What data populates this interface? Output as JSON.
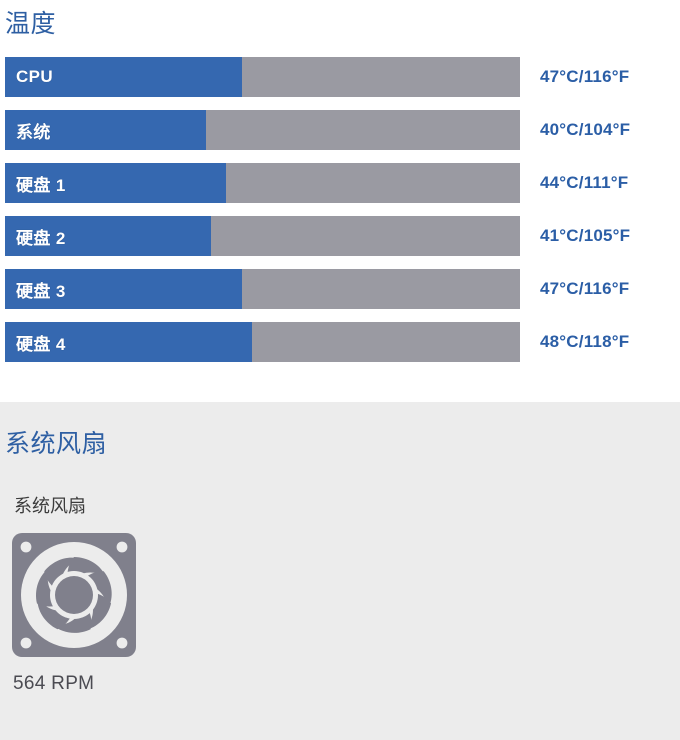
{
  "temperature": {
    "title": "温度",
    "track_color": "#9a9aa2",
    "fill_color": "#3568b0",
    "value_color": "#2b5ea6",
    "rows": [
      {
        "label": "CPU",
        "value": "47°C/116°F",
        "celsius": 47,
        "fahrenheit": 116,
        "fill_percent": 46
      },
      {
        "label": "系统",
        "value": "40°C/104°F",
        "celsius": 40,
        "fahrenheit": 104,
        "fill_percent": 39
      },
      {
        "label": "硬盘 1",
        "value": "44°C/111°F",
        "celsius": 44,
        "fahrenheit": 111,
        "fill_percent": 43
      },
      {
        "label": "硬盘 2",
        "value": "41°C/105°F",
        "celsius": 41,
        "fahrenheit": 105,
        "fill_percent": 40
      },
      {
        "label": "硬盘 3",
        "value": "47°C/116°F",
        "celsius": 47,
        "fahrenheit": 116,
        "fill_percent": 46
      },
      {
        "label": "硬盘 4",
        "value": "48°C/118°F",
        "celsius": 48,
        "fahrenheit": 118,
        "fill_percent": 48
      }
    ]
  },
  "fans": {
    "title": "系统风扇",
    "heading_color": "#2e5fa3",
    "background_color": "#ececec",
    "items": [
      {
        "label": "系统风扇",
        "icon": "fan-icon",
        "icon_body_color": "#80808c",
        "icon_blade_color": "#ececec",
        "rpm": "564 RPM",
        "rpm_value": 564
      }
    ]
  }
}
